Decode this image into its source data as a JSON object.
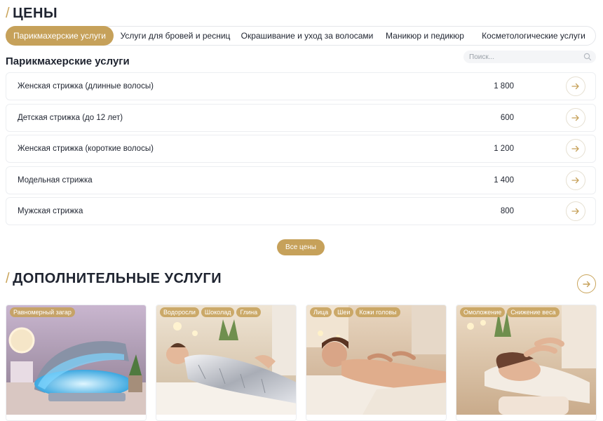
{
  "prices_section": {
    "slash": "/",
    "title": "ЦЕНЫ"
  },
  "tabs": [
    {
      "label": "Парикмахерские услуги"
    },
    {
      "label": "Услуги для бровей и ресниц"
    },
    {
      "label": "Окрашивание и уход за волосами"
    },
    {
      "label": "Маникюр и педикюр"
    },
    {
      "label": "Косметологические услуги"
    }
  ],
  "active_tab": "Парикмахерские услуги",
  "category_title": "Парикмахерские услуги",
  "search": {
    "placeholder": "Поиск..."
  },
  "services": [
    {
      "name": "Женская стрижка (длинные волосы)",
      "price": "1 800"
    },
    {
      "name": "Детская стрижка (до 12 лет)",
      "price": "600"
    },
    {
      "name": "Женская стрижка (короткие волосы)",
      "price": "1 200"
    },
    {
      "name": "Модельная стрижка",
      "price": "1 400"
    },
    {
      "name": "Мужская стрижка",
      "price": "800"
    }
  ],
  "all_prices_label": "Все цены",
  "extra_section": {
    "slash": "/",
    "title": "ДОПОЛНИТЕЛЬНЫЕ УСЛУГИ"
  },
  "cards": [
    {
      "tags": [
        "Равномерный загар"
      ],
      "image": "tanning-bed"
    },
    {
      "tags": [
        "Водоросли",
        "Шоколад",
        "Глина"
      ],
      "image": "body-wrap"
    },
    {
      "tags": [
        "Лица",
        "Шеи",
        "Кожи головы"
      ],
      "image": "back-massage"
    },
    {
      "tags": [
        "Омоложение",
        "Снижение веса"
      ],
      "image": "face-massage"
    }
  ],
  "colors": {
    "accent": "#c6a15a",
    "text": "#1f2430",
    "border": "#eceef1"
  }
}
